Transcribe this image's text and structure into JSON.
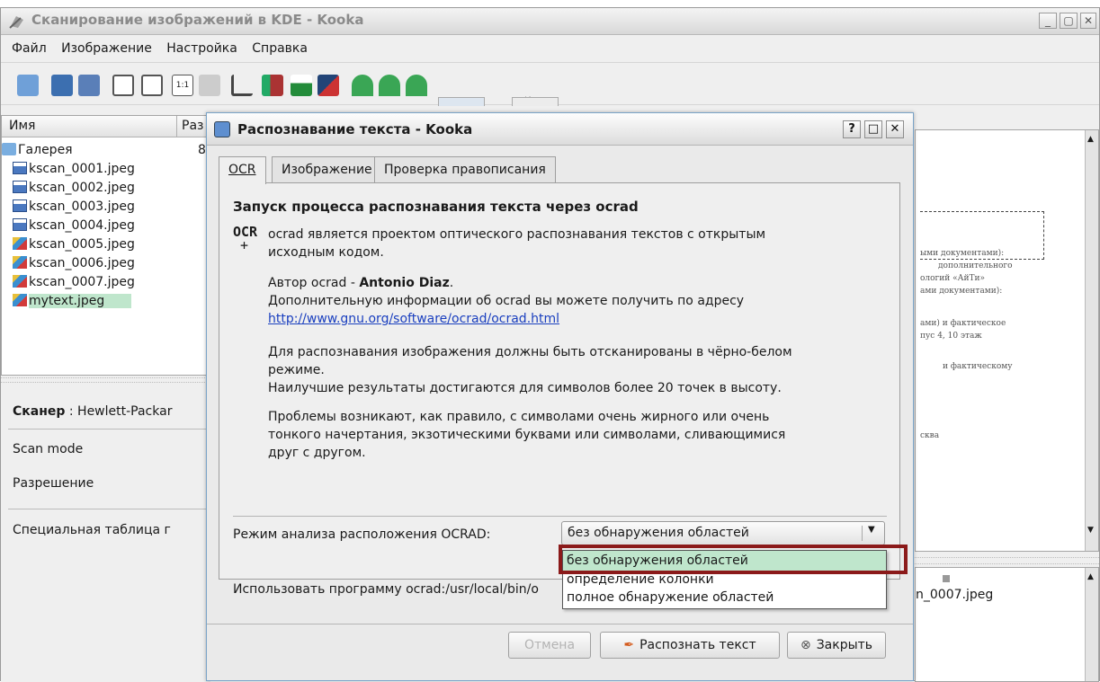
{
  "window": {
    "title": "Сканирование изображений в KDE - Kooka",
    "menus": [
      "Файл",
      "Изображение",
      "Настройка",
      "Справка"
    ]
  },
  "filetree": {
    "columns": [
      "Имя",
      "Раз"
    ],
    "root": {
      "label": "Галерея",
      "size": "8"
    },
    "items": [
      {
        "label": "kscan_0001.jpeg",
        "kind": "floppy"
      },
      {
        "label": "kscan_0002.jpeg",
        "kind": "floppy"
      },
      {
        "label": "kscan_0003.jpeg",
        "kind": "floppy"
      },
      {
        "label": "kscan_0004.jpeg",
        "kind": "floppy"
      },
      {
        "label": "kscan_0005.jpeg",
        "kind": "image"
      },
      {
        "label": "kscan_0006.jpeg",
        "kind": "image"
      },
      {
        "label": "kscan_0007.jpeg",
        "kind": "image"
      },
      {
        "label": "mytext.jpeg",
        "kind": "image",
        "selected": true
      }
    ]
  },
  "scanner": {
    "label": "Сканер",
    "name": ": Hewlett-Packar",
    "scan_mode": "Scan mode",
    "resolution": "Разрешение",
    "gamma_table": "Специальная таблица г"
  },
  "thumbnail": {
    "label": "n_0007.jpeg"
  },
  "dialog": {
    "title": "Распознавание текста - Kooka",
    "tabs": [
      "OCR",
      "Изображение",
      "Проверка правописания"
    ],
    "heading": "Запуск процесса распознавания текста через ocrad",
    "logo_text": "OCR",
    "para1_line1": "ocrad является проектом оптического распознавания текстов с открытым",
    "para1_line2": "исходным кодом.",
    "author_prefix": "Автор ocrad - ",
    "author_name": "Antonio Diaz",
    "author_suffix": ".",
    "more_info": "Дополнительную информации об ocrad вы можете получить по адресу",
    "link": "http://www.gnu.org/software/ocrad/ocrad.html",
    "para3_line1": "Для распознавания изображения должны быть отсканированы в чёрно-белом",
    "para3_line2": "режиме.",
    "para3_line3": "Наилучшие результаты достигаются для символов более 20 точек в высоту.",
    "para4_line1": "Проблемы возникают, как правило, с символами очень жирного или очень",
    "para4_line2": "тонкого начертания, экзотическими буквами или символами, сливающимися",
    "para4_line3": "друг с другом.",
    "mode_label": "Режим анализа расположения OCRAD:",
    "mode_value": "без обнаружения областей",
    "mode_options": [
      "без обнаружения областей",
      "определение колонки",
      "полное обнаружение областей"
    ],
    "program_label": "Использовать программу ocrad:/usr/local/bin/o",
    "cancel": "Отмена",
    "recognize": "Распознать текст",
    "close": "Закрыть"
  },
  "doc_preview": {
    "lines": [
      "ыми документами):",
      "дополнительного",
      "ологий «АйТи»",
      "ами документами):",
      "ами) и фактическое",
      "пус 4, 10 этаж",
      "и фактическому",
      "сква"
    ]
  },
  "colors": {
    "selection": "#bfe6cc",
    "highlight_box": "#8b1a1a",
    "link": "#1a3fbf"
  }
}
